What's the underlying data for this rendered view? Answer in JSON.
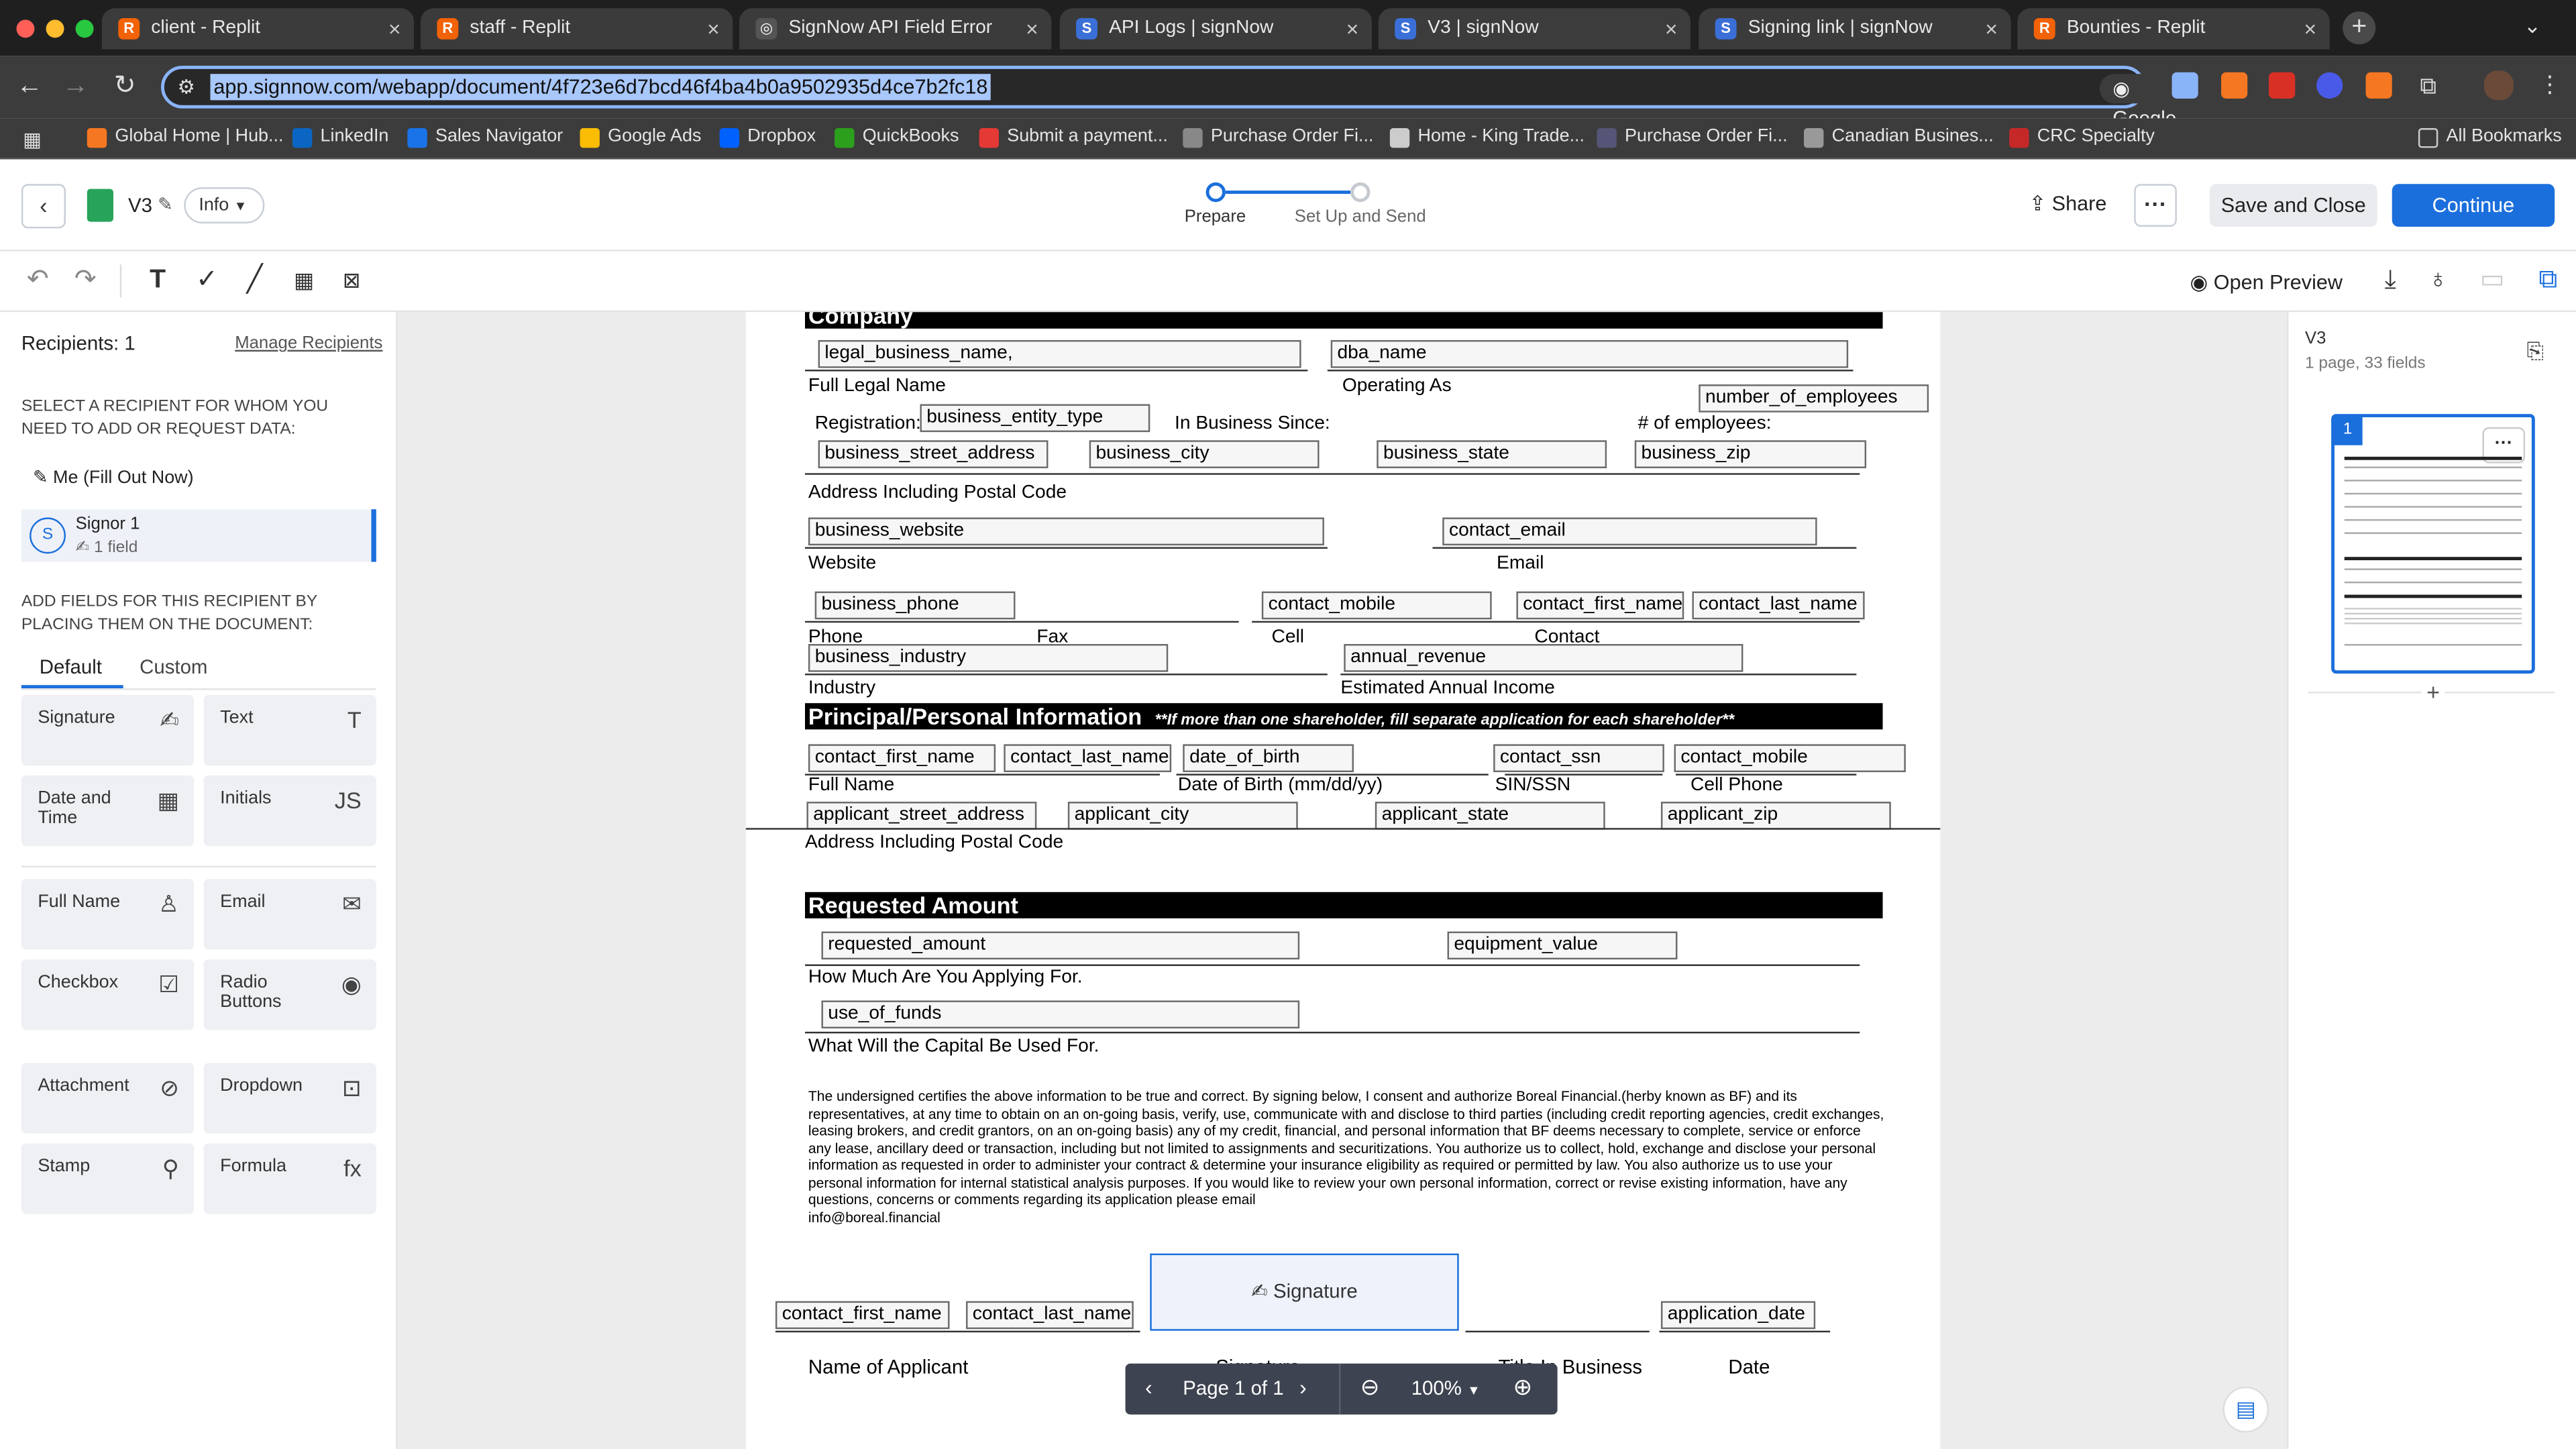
{
  "browser": {
    "tabs": [
      {
        "title": "client - Replit",
        "color": "#f26207",
        "glyph": "R"
      },
      {
        "title": "staff - Replit",
        "color": "#f26207",
        "glyph": "R"
      },
      {
        "title": "SignNow API Field Error",
        "color": "#555555",
        "glyph": "◎"
      },
      {
        "title": "API Logs | signNow",
        "color": "#3b6fd8",
        "glyph": "S"
      },
      {
        "title": "V3 | signNow",
        "color": "#3b6fd8",
        "glyph": "S"
      },
      {
        "title": "Signing link | signNow",
        "color": "#3b6fd8",
        "glyph": "S"
      },
      {
        "title": "Bounties - Replit",
        "color": "#f26207",
        "glyph": "R"
      }
    ],
    "url": "app.signnow.com/webapp/document/4f723e6d7bcd46f4ba4b0a9502935d4ce7b2fc18",
    "lens_label": "Google Lens",
    "bookmarks": [
      {
        "label": "Global Home | Hub...",
        "color": "#f57722"
      },
      {
        "label": "LinkedIn",
        "color": "#0a66c2"
      },
      {
        "label": "Sales Navigator",
        "color": "#1a73e8"
      },
      {
        "label": "Google Ads",
        "color": "#fbbc04"
      },
      {
        "label": "Dropbox",
        "color": "#0061fe"
      },
      {
        "label": "QuickBooks",
        "color": "#2ca01c"
      },
      {
        "label": "Submit a payment...",
        "color": "#e53935"
      },
      {
        "label": "Purchase Order Fi...",
        "color": "#888888"
      },
      {
        "label": "Home - King Trade...",
        "color": "#cccccc"
      },
      {
        "label": "Purchase Order Fi...",
        "color": "#555577"
      },
      {
        "label": "Canadian Busines...",
        "color": "#999999"
      },
      {
        "label": "CRC Specialty",
        "color": "#c62828"
      }
    ],
    "all_bookmarks": "All Bookmarks"
  },
  "header": {
    "doc_name": "V3",
    "info_label": "Info",
    "steps": [
      "Prepare",
      "Set Up and Send"
    ],
    "share_label": "Share",
    "save_close_label": "Save and Close",
    "continue_label": "Continue",
    "accent": "#1b6fdc"
  },
  "toolbar": {
    "open_preview": "Open Preview"
  },
  "sidebar": {
    "recipients_title": "Recipients: 1",
    "manage_link": "Manage Recipients",
    "select_prompt": "SELECT A RECIPIENT FOR WHOM YOU NEED TO ADD OR REQUEST DATA:",
    "me_label": "Me (Fill Out Now)",
    "signer": {
      "initial": "S",
      "name": "Signor 1",
      "fields": "1 field"
    },
    "add_prompt": "ADD FIELDS FOR THIS RECIPIENT BY PLACING THEM ON THE DOCUMENT:",
    "tabs": [
      "Default",
      "Custom"
    ],
    "fields": [
      {
        "label": "Signature",
        "icon": "✍"
      },
      {
        "label": "Text",
        "icon": "T"
      },
      {
        "label": "Date and Time",
        "icon": "▦"
      },
      {
        "label": "Initials",
        "icon": "JS"
      },
      {
        "label": "Full Name",
        "icon": "♙"
      },
      {
        "label": "Email",
        "icon": "✉"
      },
      {
        "label": "Checkbox",
        "icon": "☑"
      },
      {
        "label": "Radio Buttons",
        "icon": "◉"
      },
      {
        "label": "Attachment",
        "icon": "⊘"
      },
      {
        "label": "Dropdown",
        "icon": "⊡"
      },
      {
        "label": "Stamp",
        "icon": "⚲"
      },
      {
        "label": "Formula",
        "icon": "fx"
      }
    ]
  },
  "document": {
    "sections": {
      "company": "Company",
      "principal": "Principal/Personal Information",
      "principal_note": "**If more than one shareholder, fill separate application for each shareholder**",
      "requested": "Requested Amount"
    },
    "fields": {
      "legal_business_name": "legal_business_name,",
      "dba_name": "dba_name",
      "number_of_employees": "number_of_employees",
      "business_entity_type": "business_entity_type",
      "business_street_address": "business_street_address",
      "business_city": "business_city",
      "business_state": "business_state",
      "business_zip": "business_zip",
      "business_website": "business_website",
      "contact_email": "contact_email",
      "business_phone": "business_phone",
      "contact_mobile": "contact_mobile",
      "contact_first_name": "contact_first_name",
      "contact_last_name": "contact_last_name",
      "business_industry": "business_industry",
      "annual_revenue": "annual_revenue",
      "p_contact_first_name": "contact_first_name",
      "p_contact_last_name": "contact_last_name",
      "date_of_birth": "date_of_birth",
      "contact_ssn": "contact_ssn",
      "p_contact_mobile": "contact_mobile",
      "applicant_street_address": "applicant_street_address",
      "applicant_city": "applicant_city",
      "applicant_state": "applicant_state",
      "applicant_zip": "applicant_zip",
      "requested_amount": "requested_amount",
      "equipment_value": "equipment_value",
      "use_of_funds": "use_of_funds",
      "s_contact_first_name": "contact_first_name",
      "s_contact_last_name": "contact_last_name",
      "signature": "Signature",
      "application_date": "application_date"
    },
    "labels": {
      "full_legal_name": "Full Legal Name",
      "operating_as": "Operating As",
      "registration": "Registration:",
      "in_business_since": "In Business Since:",
      "num_employees": "# of employees:",
      "address_postal": "Address Including Postal Code",
      "website": "Website",
      "email": "Email",
      "phone": "Phone",
      "fax": "Fax",
      "cell": "Cell",
      "contact": "Contact",
      "industry": "Industry",
      "est_income": "Estimated Annual Income",
      "full_name": "Full Name",
      "dob": "Date of Birth (mm/dd/yy)",
      "sin": "SIN/SSN",
      "cell_phone": "Cell Phone",
      "applicant_address": "Address Including Postal Code",
      "how_much": "How Much Are You Applying For.",
      "capital_use": "What Will the Capital Be Used For.",
      "name_of_applicant": "Name of Applicant",
      "signature_label": "Signature",
      "title_in_business": "Title In Business",
      "date": "Date"
    },
    "disclaimer": "The undersigned certifies the above information to be true and correct. By signing below, I consent and authorize Boreal Financial.(herby known as BF) and its representatives, at any time to obtain on an on-going basis, verify, use, communicate with and disclose to third parties (including credit reporting agencies, credit exchanges, leasing brokers, and credit grantors, on an on-going basis) any of my credit, financial, and personal information that BF deems necessary to complete, service or enforce any lease, ancillary deed or transaction, including but not limited to assignments and securitizations. You authorize us to collect, hold, exchange and disclose your personal information as requested in order to administer your contract & determine your insurance eligibility as required or permitted by law. You also authorize us to use your personal information for internal statistical analysis purposes. If you would like to review your own personal information, correct or revise existing information, have any questions, concerns or comments regarding its application please email",
    "email_contact": "info@boreal.financial"
  },
  "pager": {
    "page_label": "Page 1 of 1",
    "zoom": "100%"
  },
  "right_panel": {
    "doc_name": "V3",
    "summary": "1 page, 33 fields",
    "thumb_number": "1"
  }
}
